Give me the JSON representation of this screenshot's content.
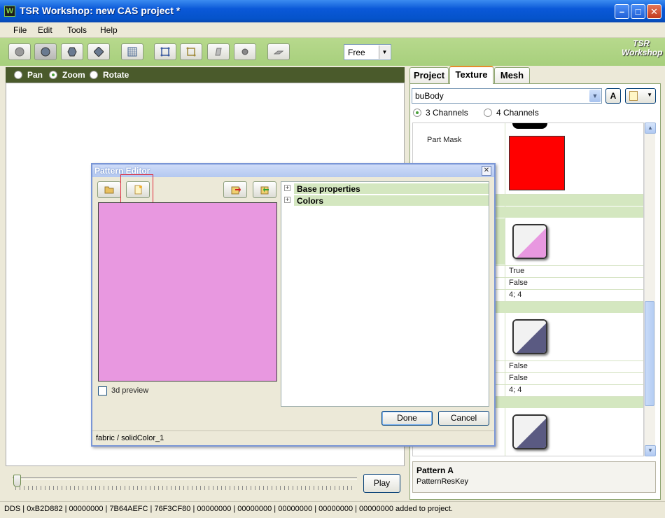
{
  "window": {
    "title": "TSR Workshop: new CAS project *",
    "app_icon": "W"
  },
  "menu": [
    "File",
    "Edit",
    "Tools",
    "Help"
  ],
  "toolbar": {
    "view_mode": "Free",
    "logo": "TSR Workshop"
  },
  "viewport": {
    "modes": [
      "Pan",
      "Zoom",
      "Rotate"
    ],
    "selected_mode": "Zoom"
  },
  "playback": {
    "play_label": "Play"
  },
  "tabs": [
    "Project",
    "Texture",
    "Mesh"
  ],
  "active_tab": "Texture",
  "texture": {
    "mesh_select": "buBody",
    "a_button": "A",
    "channels": [
      "3 Channels",
      "4 Channels"
    ],
    "selected_channel": "3 Channels"
  },
  "properties": {
    "part_mask_label": "Part Mask",
    "part_mask_color": "#ff0000",
    "pattern_a": {
      "enabled": "True",
      "tiling_flag": "False",
      "tiling": "4; 4",
      "color": "#e898e0"
    },
    "pattern_b": {
      "enabled": "False",
      "tiling_flag": "False",
      "tiling": "4; 4",
      "color": "#5a5a82"
    },
    "pattern_c_color": "#5a5a82"
  },
  "description": {
    "title": "Pattern A",
    "text": "PatternResKey"
  },
  "status": "DDS | 0xB2D882 | 00000000 | 7B64AEFC | 76F3CF80 | 00000000 | 00000000 | 00000000 | 00000000 | 00000000 added to project.",
  "pattern_editor": {
    "title": "Pattern Editor",
    "preview_color": "#e898e0",
    "preview_3d_label": "3d preview",
    "tree": [
      "Base properties",
      "Colors"
    ],
    "done_label": "Done",
    "cancel_label": "Cancel",
    "status": "fabric / solidColor_1"
  }
}
